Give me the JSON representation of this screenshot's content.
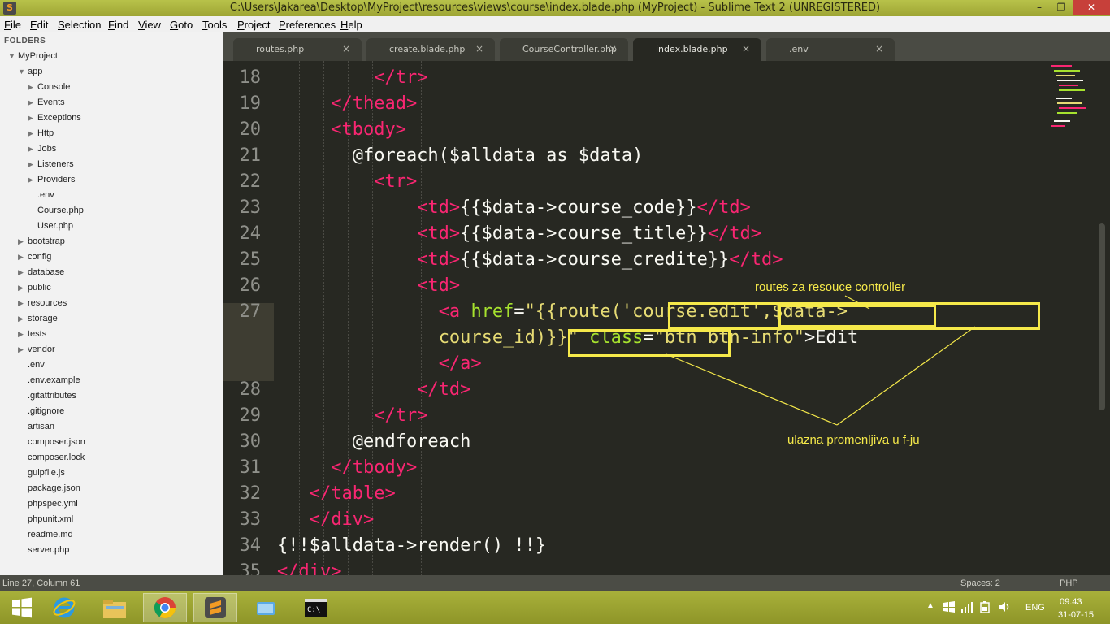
{
  "window": {
    "title": "C:\\Users\\Jakarea\\Desktop\\MyProject\\resources\\views\\course\\index.blade.php (MyProject) - Sublime Text 2 (UNREGISTERED)",
    "minimize": "–",
    "maximize": "❐",
    "close": "✕"
  },
  "menu": [
    "File",
    "Edit",
    "Selection",
    "Find",
    "View",
    "Goto",
    "Tools",
    "Project",
    "Preferences",
    "Help"
  ],
  "sidebar": {
    "header": "FOLDERS",
    "items": [
      {
        "label": "MyProject",
        "type": "folder-open",
        "depth": 0
      },
      {
        "label": "app",
        "type": "folder-open",
        "depth": 1
      },
      {
        "label": "Console",
        "type": "folder",
        "depth": 2
      },
      {
        "label": "Events",
        "type": "folder",
        "depth": 2
      },
      {
        "label": "Exceptions",
        "type": "folder",
        "depth": 2
      },
      {
        "label": "Http",
        "type": "folder",
        "depth": 2
      },
      {
        "label": "Jobs",
        "type": "folder",
        "depth": 2
      },
      {
        "label": "Listeners",
        "type": "folder",
        "depth": 2
      },
      {
        "label": "Providers",
        "type": "folder",
        "depth": 2
      },
      {
        "label": ".env",
        "type": "file",
        "depth": 2
      },
      {
        "label": "Course.php",
        "type": "file",
        "depth": 2
      },
      {
        "label": "User.php",
        "type": "file",
        "depth": 2
      },
      {
        "label": "bootstrap",
        "type": "folder",
        "depth": 1
      },
      {
        "label": "config",
        "type": "folder",
        "depth": 1
      },
      {
        "label": "database",
        "type": "folder",
        "depth": 1
      },
      {
        "label": "public",
        "type": "folder",
        "depth": 1
      },
      {
        "label": "resources",
        "type": "folder",
        "depth": 1
      },
      {
        "label": "storage",
        "type": "folder",
        "depth": 1
      },
      {
        "label": "tests",
        "type": "folder",
        "depth": 1
      },
      {
        "label": "vendor",
        "type": "folder",
        "depth": 1
      },
      {
        "label": ".env",
        "type": "file",
        "depth": 1
      },
      {
        "label": ".env.example",
        "type": "file",
        "depth": 1
      },
      {
        "label": ".gitattributes",
        "type": "file",
        "depth": 1
      },
      {
        "label": ".gitignore",
        "type": "file",
        "depth": 1
      },
      {
        "label": "artisan",
        "type": "file",
        "depth": 1
      },
      {
        "label": "composer.json",
        "type": "file",
        "depth": 1
      },
      {
        "label": "composer.lock",
        "type": "file",
        "depth": 1
      },
      {
        "label": "gulpfile.js",
        "type": "file",
        "depth": 1
      },
      {
        "label": "package.json",
        "type": "file",
        "depth": 1
      },
      {
        "label": "phpspec.yml",
        "type": "file",
        "depth": 1
      },
      {
        "label": "phpunit.xml",
        "type": "file",
        "depth": 1
      },
      {
        "label": "readme.md",
        "type": "file",
        "depth": 1
      },
      {
        "label": "server.php",
        "type": "file",
        "depth": 1
      }
    ]
  },
  "tabs": [
    {
      "label": "routes.php",
      "active": false
    },
    {
      "label": "create.blade.php",
      "active": false
    },
    {
      "label": "CourseController.php",
      "active": false
    },
    {
      "label": "index.blade.php",
      "active": true
    },
    {
      "label": ".env",
      "active": false
    }
  ],
  "tab_close": "×",
  "editor": {
    "line_numbers": [
      "18",
      "19",
      "20",
      "21",
      "22",
      "23",
      "24",
      "25",
      "26",
      "27",
      "28",
      "29",
      "30",
      "31",
      "32",
      "33",
      "34",
      "35"
    ],
    "current_line": "27"
  },
  "annotations": {
    "top_note": "routes za resouce controller",
    "bottom_note": "ulazna promenljiva u f-ju",
    "color": "#f5e94a"
  },
  "status": {
    "position": "Line 27, Column 61",
    "spaces": "Spaces: 2",
    "syntax": "PHP"
  },
  "taskbar": {
    "lang": "ENG",
    "time": "09.43",
    "date": "31-07-15"
  },
  "colors": {
    "tag": "#f92672",
    "attr": "#a6e22e",
    "string": "#e6db74",
    "text": "#f8f8f2",
    "background": "#272822"
  }
}
